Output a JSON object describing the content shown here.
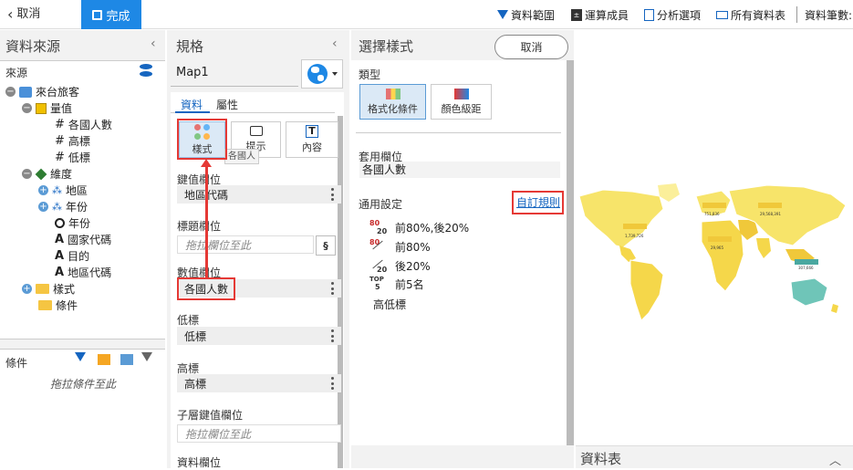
{
  "topbar": {
    "cancel": "取消",
    "done": "完成",
    "data_range": "資料範圍",
    "calc_members": "運算成員",
    "analysis_options": "分析選項",
    "all_tables": "所有資料表",
    "row_count": "資料筆數:"
  },
  "source_panel": {
    "title": "資料來源",
    "source_label": "來源",
    "tree": {
      "root": "來台旅客",
      "measures": "量值",
      "measure_items": [
        "各國人數",
        "高標",
        "低標"
      ],
      "dimensions": "維度",
      "dimension_items": [
        "地區",
        "年份",
        "年份",
        "國家代碼",
        "目的",
        "地區代碼"
      ],
      "style": "樣式",
      "condition": "條件"
    },
    "filter_label": "條件",
    "filter_drop": "拖拉條件至此"
  },
  "spec_panel": {
    "title": "規格",
    "map_name": "Map1",
    "tabs": [
      "資料",
      "屬性"
    ],
    "buttons": [
      "樣式",
      "提示",
      "內容"
    ],
    "tooltip": "各國人",
    "fields": [
      {
        "label": "鍵值欄位",
        "value": "地區代碼",
        "drop": false
      },
      {
        "label": "標題欄位",
        "value": "拖拉欄位至此",
        "drop": true
      },
      {
        "label": "數值欄位",
        "value": "各國人數",
        "drop": false
      },
      {
        "label": "低標",
        "value": "低標",
        "drop": false
      },
      {
        "label": "高標",
        "value": "高標",
        "drop": false
      },
      {
        "label": "子層鍵值欄位",
        "value": "拖拉欄位至此",
        "drop": true
      },
      {
        "label": "資料欄位",
        "value": "",
        "drop": false
      }
    ]
  },
  "style_panel": {
    "title": "選擇樣式",
    "cancel": "取消",
    "type_label": "類型",
    "type_buttons": [
      "格式化條件",
      "顏色級距"
    ],
    "apply_field_label": "套用欄位",
    "apply_field_value": "各國人數",
    "general_label": "通用設定",
    "custom_rule": "自訂規則",
    "conditions": [
      "前80%,後20%",
      "前80%",
      "後20%",
      "前5名",
      "高低標"
    ]
  },
  "map": {
    "labels": [
      "751,836",
      "1,739,726",
      "29,568,391",
      "29,965",
      "307,666"
    ]
  },
  "bottom": {
    "data_table": "資料表"
  }
}
